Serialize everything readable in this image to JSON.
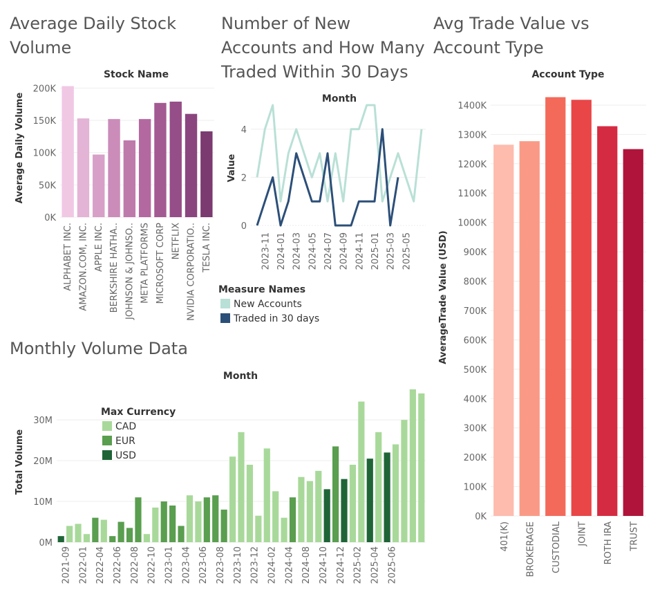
{
  "chart_data": [
    {
      "id": "stock_volume",
      "type": "bar",
      "title": "Average Daily Stock Volume",
      "header": "Stock Name",
      "ylabel": "Average Daily Volume",
      "categories": [
        "ALPHABET INC.",
        "AMAZON.COM, INC.",
        "APPLE INC.",
        "BERKSHIRE HATHA..",
        "JOHNSON & JOHNSO..",
        "META PLATFORMS",
        "MICROSOFT CORP",
        "NETFLIX",
        "NVIDIA CORPORATIO..",
        "TESLA INC."
      ],
      "values": [
        203000,
        153000,
        97000,
        152000,
        119000,
        152000,
        177000,
        179000,
        160000,
        133000
      ],
      "colors": [
        "#f0c8e4",
        "#e3b4d6",
        "#d7a0c8",
        "#cb8cba",
        "#bf7aac",
        "#b3699f",
        "#a35a92",
        "#964e88",
        "#8a457f",
        "#7b3a70"
      ],
      "yticks": [
        0,
        50000,
        100000,
        150000,
        200000
      ],
      "ytick_labels": [
        "0K",
        "50K",
        "100K",
        "150K",
        "200K"
      ],
      "ylim": [
        0,
        210000
      ]
    },
    {
      "id": "new_accounts",
      "type": "line",
      "title": "Number of New Accounts and How Many Traded Within 30 Days",
      "header": "Month",
      "ylabel": "Value",
      "xtick_labels": [
        "2023-11",
        "2024-01",
        "2024-03",
        "2024-05",
        "2024-07",
        "2024-09",
        "2024-11",
        "2025-01",
        "2025-03",
        "2025-05"
      ],
      "xtick_index": [
        1,
        3,
        5,
        7,
        9,
        11,
        13,
        15,
        17,
        19
      ],
      "yticks": [
        0,
        2,
        4
      ],
      "ylim": [
        0,
        5
      ],
      "legend_title": "Measure Names",
      "series": [
        {
          "name": "New Accounts",
          "color": "#b9e0d6",
          "values": [
            2,
            4,
            5,
            1,
            3,
            4,
            3,
            2,
            3,
            1,
            3,
            1,
            4,
            4,
            5,
            5,
            1,
            2,
            3,
            2,
            1,
            4
          ]
        },
        {
          "name": "Traded in 30 days",
          "color": "#2c4f78",
          "values": [
            0,
            1,
            2,
            0,
            1,
            3,
            2,
            1,
            1,
            3,
            0,
            0,
            0,
            1,
            1,
            1,
            4,
            0,
            2,
            null,
            null,
            null
          ]
        }
      ]
    },
    {
      "id": "monthly_volume",
      "type": "bar",
      "title": "Monthly Volume Data",
      "header": "Month",
      "ylabel": "Total Volume",
      "legend_title": "Max Currency",
      "legend": [
        {
          "name": "CAD",
          "color": "#a8d99a"
        },
        {
          "name": "EUR",
          "color": "#5a9e4f"
        },
        {
          "name": "USD",
          "color": "#1f6437"
        }
      ],
      "values": [
        1.5,
        4,
        4.5,
        2,
        6,
        5.5,
        1.5,
        5,
        3.5,
        11,
        2,
        8.5,
        10,
        9,
        4,
        11.5,
        10,
        11,
        11.5,
        8,
        21,
        27,
        19,
        6.5,
        23,
        12.5,
        6,
        11,
        16,
        15,
        17.5,
        13,
        23.5,
        15.5,
        19,
        34.5,
        20.5,
        27,
        22,
        24,
        30,
        37.5,
        36.5
      ],
      "currency": [
        "USD",
        "CAD",
        "CAD",
        "CAD",
        "EUR",
        "CAD",
        "EUR",
        "EUR",
        "EUR",
        "EUR",
        "CAD",
        "CAD",
        "EUR",
        "EUR",
        "EUR",
        "CAD",
        "CAD",
        "EUR",
        "EUR",
        "EUR",
        "CAD",
        "CAD",
        "CAD",
        "CAD",
        "CAD",
        "CAD",
        "CAD",
        "EUR",
        "CAD",
        "CAD",
        "CAD",
        "USD",
        "EUR",
        "USD",
        "CAD",
        "CAD",
        "USD",
        "CAD",
        "USD",
        "CAD",
        "CAD",
        "CAD",
        "CAD"
      ],
      "xtick_labels": [
        "2021-09",
        "2022-01",
        "2022-04",
        "2022-06",
        "2022-08",
        "2022-10",
        "2023-01",
        "2023-04",
        "2023-06",
        "2023-08",
        "2023-10",
        "2023-12",
        "2024-02",
        "2024-04",
        "2024-08",
        "2024-10",
        "2024-12",
        "2025-02",
        "2025-04",
        "2025-06"
      ],
      "xtick_index": [
        0,
        2,
        4,
        6,
        8,
        10,
        12,
        14,
        16,
        18,
        20,
        22,
        24,
        26,
        28,
        30,
        32,
        34,
        36,
        38,
        40
      ],
      "yticks": [
        0,
        10,
        20,
        30
      ],
      "ytick_labels": [
        "0M",
        "10M",
        "20M",
        "30M"
      ],
      "ylim": [
        0,
        38
      ]
    },
    {
      "id": "trade_value",
      "type": "bar",
      "title": "Avg Trade Value vs Account Type",
      "header": "Account Type",
      "ylabel": "AverageTrade Value (USD)",
      "categories": [
        "401(K)",
        "BROKERAGE",
        "CUSTODIAL",
        "JOINT",
        "ROTH IRA",
        "TRUST"
      ],
      "values": [
        1265000,
        1277000,
        1427000,
        1418000,
        1328000,
        1250000
      ],
      "colors": [
        "#fdbcae",
        "#fa9a86",
        "#f36a5a",
        "#e84647",
        "#d52b42",
        "#b0143b"
      ],
      "yticks": [
        0,
        100000,
        200000,
        300000,
        400000,
        500000,
        600000,
        700000,
        800000,
        900000,
        1000000,
        1100000,
        1200000,
        1300000,
        1400000
      ],
      "ytick_labels": [
        "0K",
        "100K",
        "200K",
        "300K",
        "400K",
        "500K",
        "600K",
        "700K",
        "800K",
        "900K",
        "1000K",
        "1100K",
        "1200K",
        "1300K",
        "1400K"
      ],
      "ylim": [
        0,
        1480000
      ]
    }
  ],
  "line_legend_colors": [
    "#b9e0d6",
    "#2c4f78"
  ]
}
